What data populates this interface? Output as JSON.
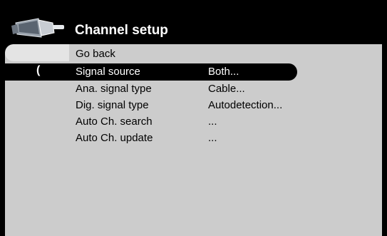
{
  "header": {
    "title": "Channel setup",
    "icon": "plug-icon"
  },
  "menu": {
    "go_back": "Go back",
    "caret": "(",
    "items": [
      {
        "label": "Signal source",
        "value": "Both...",
        "selected": true
      },
      {
        "label": "Ana. signal type",
        "value": "Cable..."
      },
      {
        "label": "Dig. signal type",
        "value": "Autodetection..."
      },
      {
        "label": "Auto Ch. search",
        "value": "..."
      },
      {
        "label": "Auto Ch. update",
        "value": "..."
      }
    ]
  },
  "colors": {
    "background": "#000000",
    "panel": "#cccccc",
    "highlight": "#e4e4e4",
    "selected_bar": "#000000",
    "text": "#000000",
    "selected_text": "#ffffff"
  }
}
